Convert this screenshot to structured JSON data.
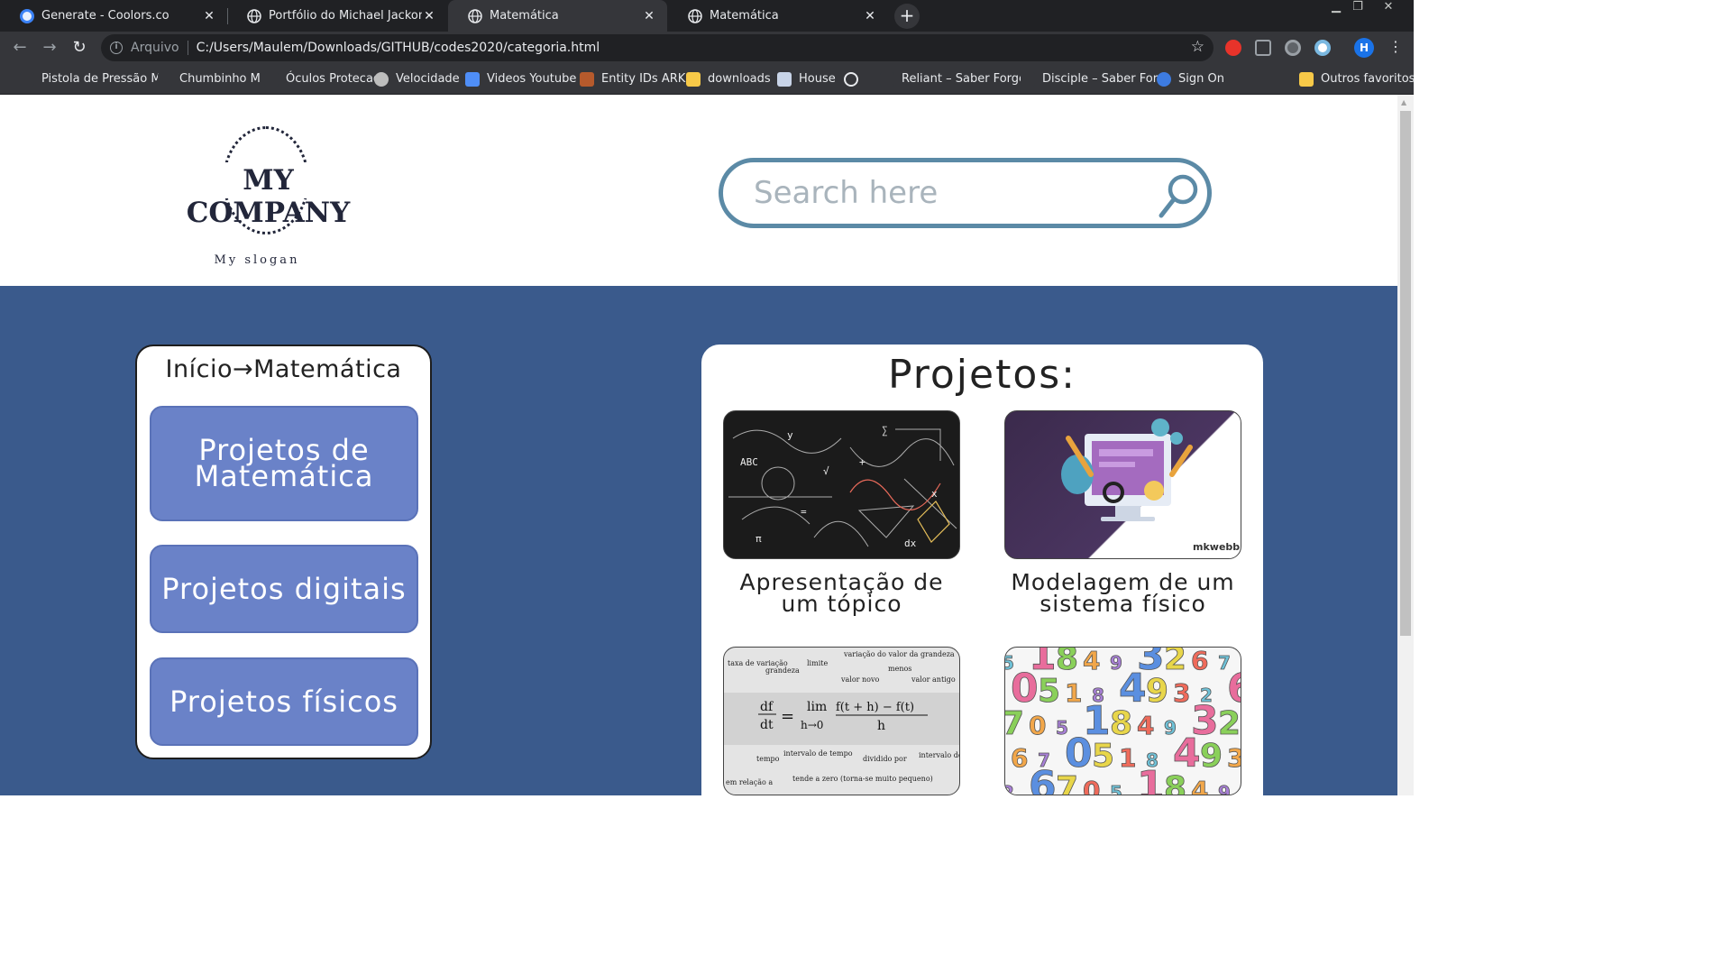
{
  "browser": {
    "tabs": [
      {
        "title": "Generate - Coolors.co",
        "active": false
      },
      {
        "title": "Portfólio do Michael Jackons",
        "active": false
      },
      {
        "title": "Matemática",
        "active": true
      },
      {
        "title": "Matemática",
        "active": false
      }
    ],
    "address": {
      "scheme": "Arquivo",
      "url": "C:/Users/Maulem/Downloads/GITHUB/codes2020/categoria.html"
    },
    "profile_initial": "H",
    "bookmarks": [
      "Pistola de Pressão M",
      "Chumbinho M",
      "Óculos Protecao",
      "Velocidade",
      "Videos Youtube",
      "Entity IDs ARK",
      "downloads",
      "House",
      "",
      "Reliant – Saber Forge",
      "Disciple – Saber For...",
      "Sign On"
    ],
    "other_bookmarks": "Outros favoritos"
  },
  "header": {
    "logo_text": "MY COMPANY",
    "slogan": "My slogan",
    "search_placeholder": "Search here"
  },
  "sidebar": {
    "breadcrumb": "Início→Matemática",
    "categories": [
      "Projetos de Matemática",
      "Projetos digitais",
      "Projetos físicos"
    ]
  },
  "projects": {
    "title": "Projetos:",
    "items": [
      {
        "caption": "Apresentação de um tópico"
      },
      {
        "caption": "Modelagem de um sistema físico"
      },
      {
        "caption": ""
      },
      {
        "caption": ""
      }
    ]
  },
  "thumbnails": {
    "chalkboard_text": [
      "ABC",
      "x",
      "y",
      "√",
      "∑",
      "π",
      "dx",
      "=",
      "+"
    ],
    "branding": "mkwebb",
    "formula": {
      "labels": [
        "taxa de variação",
        "grandeza",
        "limite",
        "variação do valor da grandeza",
        "menos",
        "valor novo",
        "valor antigo",
        "tempo",
        "intervalo de tempo",
        "dividido por",
        "intervalo de tempo",
        "tende a zero (torna-se muito pequeno)",
        "em relação a"
      ],
      "lhs_num": "df",
      "lhs_den": "dt",
      "eq": "=",
      "lim": "lim",
      "lim_sub": "h→0",
      "num": "f(t + h) − f(t)",
      "den": "h"
    },
    "numbers": [
      "5",
      "1",
      "8",
      "4",
      "9",
      "3",
      "2",
      "6",
      "7",
      "0"
    ]
  },
  "colors": {
    "main_bg": "#3a5a8c",
    "button_bg": "#6a82c8",
    "search_border": "#5b8aa6"
  }
}
